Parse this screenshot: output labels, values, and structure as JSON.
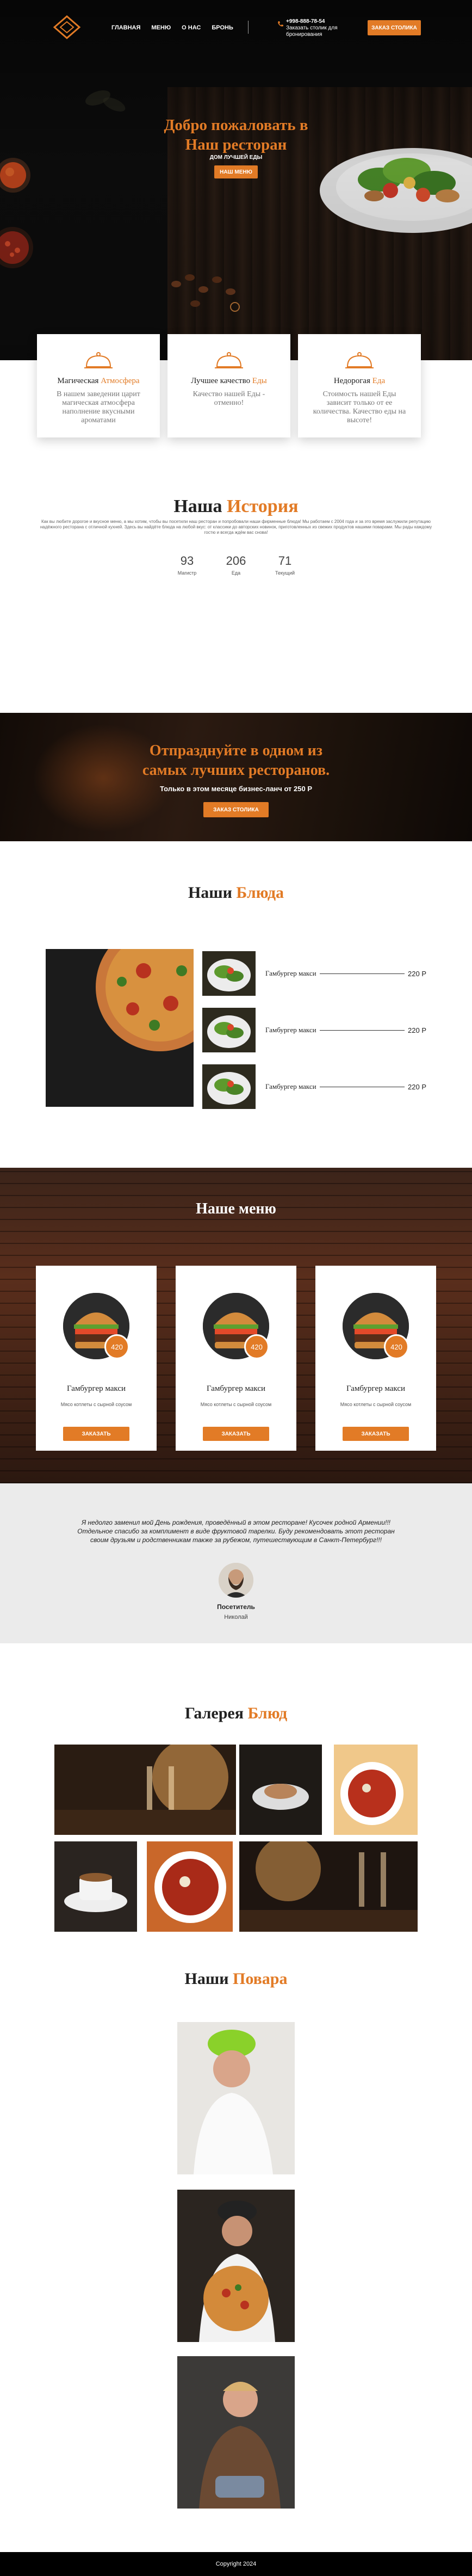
{
  "header": {
    "nav": [
      "ГЛАВНАЯ",
      "МЕНЮ",
      "О НАС",
      "БРОНЬ"
    ],
    "phone": "+998-888-78-54",
    "phone_note_1": "Заказать столик для",
    "phone_note_2": "бронирования",
    "order_button": "ЗАКАЗ СТОЛИКА"
  },
  "hero": {
    "title_line1": "Добро пожаловать в",
    "title_line2": "Наш ресторан",
    "subtitle": "ДОМ ЛУЧШЕЙ ЕДЫ",
    "button": "НАШ МЕНЮ"
  },
  "features": [
    {
      "title_a": "Магическая ",
      "title_b": "Атмосфера",
      "text": "В нашем заведении царит магическая атмосфера наполнение вкусными ароматами"
    },
    {
      "title_a": "Лучшее качество ",
      "title_b": "Еды",
      "text": "Качество нашей Еды - отменно!"
    },
    {
      "title_a": "Недорогая ",
      "title_b": "Еда",
      "text": "Стоимость нашей Еды зависит только от ее количества. Качество еды на высоте!"
    }
  ],
  "history": {
    "title_a": "Наша ",
    "title_b": "История",
    "text": "Как вы любите дорогое и вкусное меню, а мы хотим, чтобы вы посетили наш ресторан и попробовали наши фирменные блюда! Мы работаем с 2004 года и за это время заслужили репутацию надёжного ресторана с отличной кухней. Здесь вы найдёте блюда на любой вкус: от классики до авторских новинок, приготовленных из свежих продуктов нашими поварами. Мы рады каждому гостю и всегда ждём вас снова!",
    "stats": [
      {
        "value": "93",
        "label": "Магистр"
      },
      {
        "value": "206",
        "label": "Еда"
      },
      {
        "value": "71",
        "label": "Текущий"
      }
    ]
  },
  "cta": {
    "title_line1": "Отпразднуйте в одном из",
    "title_line2": "самых лучших ресторанов.",
    "subtitle": "Только в этом месяце бизнес-ланч от 250 Р",
    "button": "ЗАКАЗ СТОЛИКА"
  },
  "dishes": {
    "title_a": "Наши ",
    "title_b": "Блюда",
    "items": [
      {
        "name": "Гамбургер макси",
        "price": "220 Р"
      },
      {
        "name": "Гамбургер макси",
        "price": "220 Р"
      },
      {
        "name": "Гамбургер макси",
        "price": "220 Р"
      }
    ]
  },
  "menu": {
    "title": "Наше меню",
    "items": [
      {
        "name": "Гамбургер макси",
        "desc": "Мясо котлеты с сырной соусом",
        "price": "420",
        "button": "ЗАКАЗАТЬ"
      },
      {
        "name": "Гамбургер макси",
        "desc": "Мясо котлеты с сырной соусом",
        "price": "420",
        "button": "ЗАКАЗАТЬ"
      },
      {
        "name": "Гамбургер макси",
        "desc": "Мясо котлеты с сырной соусом",
        "price": "420",
        "button": "ЗАКАЗАТЬ"
      }
    ]
  },
  "review": {
    "text": "Я недолго заменил мой День рождения, проведённый в этом ресторане! Кусочек родной Армении!!! Отдельное спасибо за комплимент в виде фруктовой тарелки. Буду рекомендовать этот ресторан своим друзьям и родственникам также за рубежом, путешествующим в Санкт-Петербург!!!",
    "role": "Посетитель",
    "name": "Николай"
  },
  "gallery": {
    "title_a": "Галерея ",
    "title_b": "Блюд"
  },
  "chefs": {
    "title_a": "Наши ",
    "title_b": "Повара"
  },
  "footer": {
    "copyright": "Copyright 2024"
  },
  "colors": {
    "accent": "#e27b26",
    "dark": "#0d0d0d",
    "review_bg": "#ebebeb"
  }
}
